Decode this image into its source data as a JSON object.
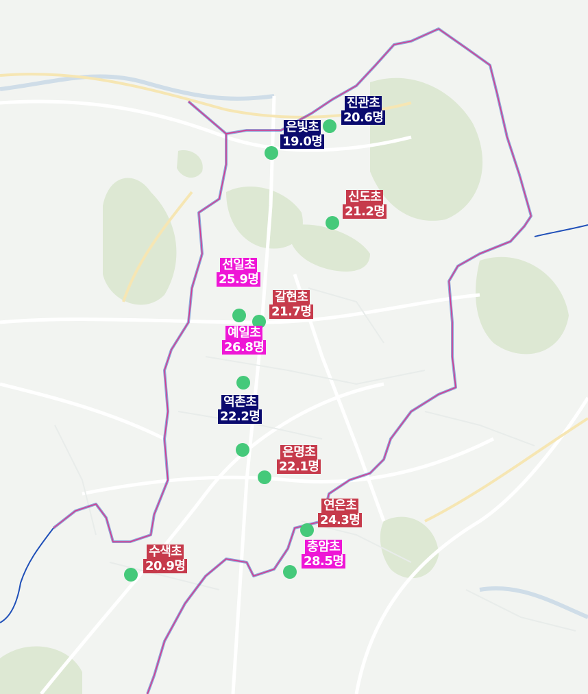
{
  "colors": {
    "marker": "#45c97a",
    "low": "#0a0a6e",
    "mid": "#c63a4b",
    "high": "#ee16d6",
    "district_border": "#d63a8e",
    "city_border": "#1f4fb8"
  },
  "schools": [
    {
      "id": "jingwan",
      "name": "진관초",
      "value": "20.6명",
      "level": "low"
    },
    {
      "id": "eunbit",
      "name": "은빛초",
      "value": "19.0명",
      "level": "low"
    },
    {
      "id": "sindo",
      "name": "신도초",
      "value": "21.2명",
      "level": "mid"
    },
    {
      "id": "seonil",
      "name": "선일초",
      "value": "25.9명",
      "level": "high"
    },
    {
      "id": "galhyeon",
      "name": "갈현초",
      "value": "21.7명",
      "level": "mid"
    },
    {
      "id": "yeil",
      "name": "예일초",
      "value": "26.8명",
      "level": "high"
    },
    {
      "id": "yeokchon",
      "name": "역촌초",
      "value": "22.2명",
      "level": "low"
    },
    {
      "id": "eunmyeong",
      "name": "은명초",
      "value": "22.1명",
      "level": "mid"
    },
    {
      "id": "yeoneun",
      "name": "연은초",
      "value": "24.3명",
      "level": "mid"
    },
    {
      "id": "chungam",
      "name": "충암초",
      "value": "28.5명",
      "level": "high"
    },
    {
      "id": "susaek",
      "name": "수색초",
      "value": "20.9명",
      "level": "mid"
    }
  ]
}
